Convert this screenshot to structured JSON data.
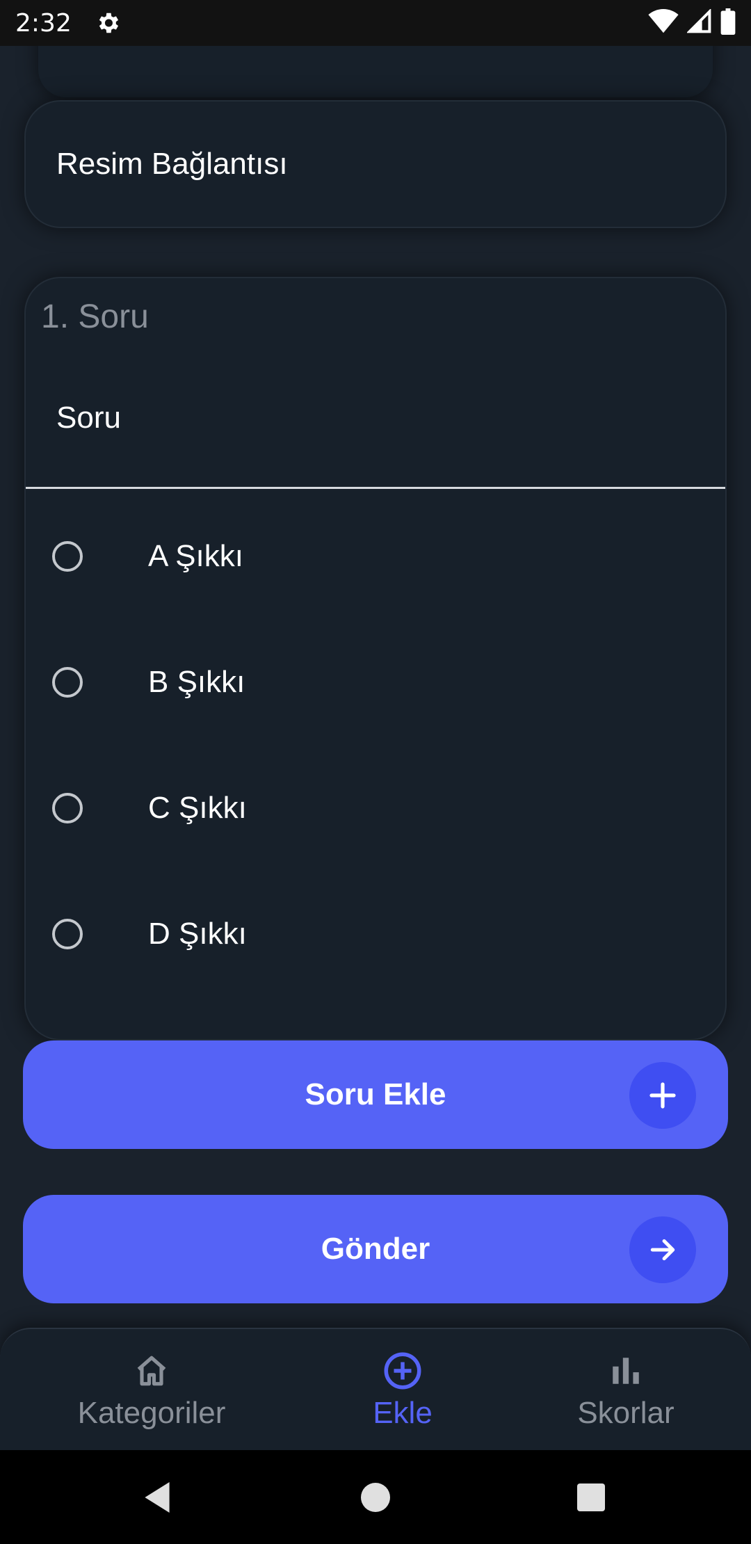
{
  "status_bar": {
    "time": "2:32",
    "icons": [
      "settings-icon",
      "wifi-icon",
      "signal-icon",
      "battery-icon"
    ]
  },
  "form": {
    "image_link_label": "Resim Bağlantısı",
    "question_title": "1. Soru",
    "question_input_label": "Soru",
    "options": [
      {
        "label": "A Şıkkı",
        "selected": false
      },
      {
        "label": "B Şıkkı",
        "selected": false
      },
      {
        "label": "C Şıkkı",
        "selected": false
      },
      {
        "label": "D Şıkkı",
        "selected": false
      }
    ]
  },
  "buttons": {
    "add_question": {
      "label": "Soru Ekle",
      "icon": "plus-icon"
    },
    "submit": {
      "label": "Gönder",
      "icon": "arrow-right-icon"
    }
  },
  "bottom_nav": {
    "items": [
      {
        "label": "Kategoriler",
        "icon": "home-icon",
        "active": false
      },
      {
        "label": "Ekle",
        "icon": "add-circle-icon",
        "active": true
      },
      {
        "label": "Skorlar",
        "icon": "bar-chart-icon",
        "active": false
      }
    ]
  },
  "colors": {
    "background": "#1a222c",
    "card": "#17202a",
    "accent": "#5563f6",
    "accent_dark": "#3f4ef2",
    "nav_active": "#5563f6",
    "nav_inactive": "#8a9099"
  }
}
